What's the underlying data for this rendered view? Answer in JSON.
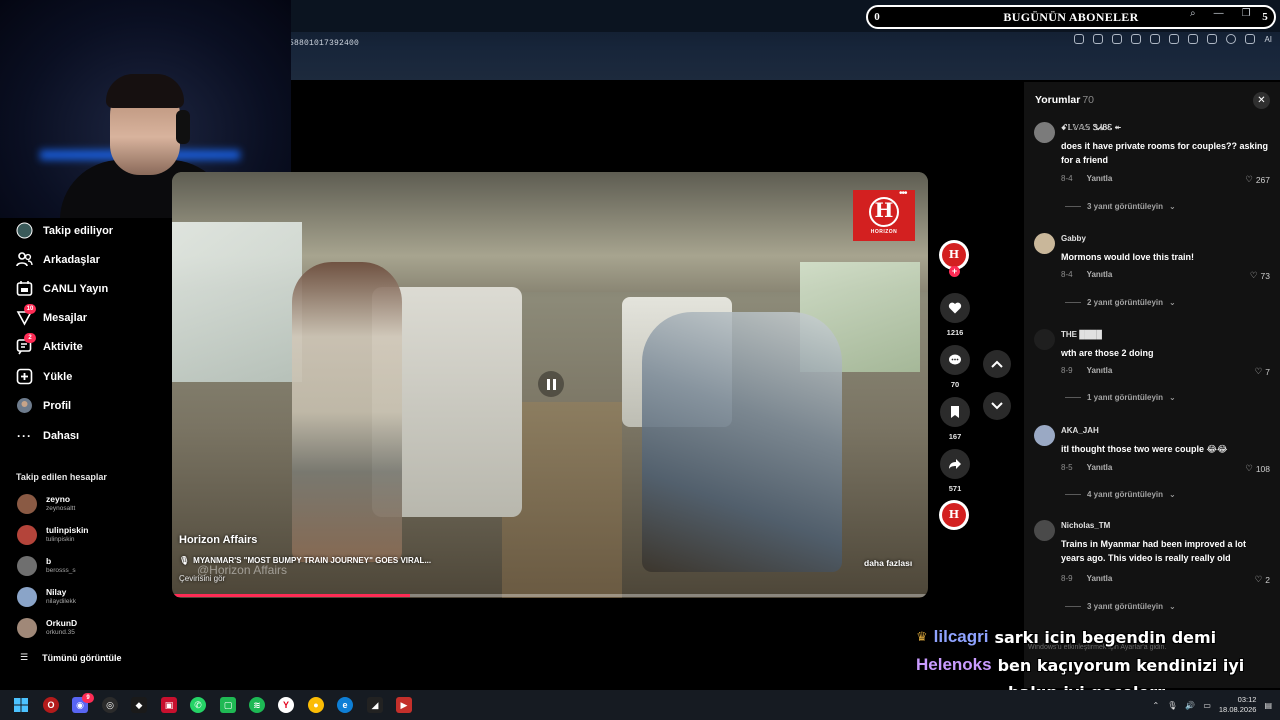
{
  "browser": {
    "url_fragment": "058801017392400",
    "ext_ai_label": "AI"
  },
  "subs_bar": {
    "left_count": "0",
    "title": "BUGÜNÜN ABONELER",
    "right_count": "5"
  },
  "sidebar": {
    "items": [
      {
        "label": "Takip ediliyor",
        "icon": "following-icon"
      },
      {
        "label": "Arkadaşlar",
        "icon": "friends-icon"
      },
      {
        "label": "CANLI Yayın",
        "icon": "live-icon"
      },
      {
        "label": "Mesajlar",
        "icon": "messages-icon",
        "badge": "10"
      },
      {
        "label": "Aktivite",
        "icon": "activity-icon",
        "badge": "2"
      },
      {
        "label": "Yükle",
        "icon": "upload-icon"
      },
      {
        "label": "Profil",
        "icon": "profile-icon"
      },
      {
        "label": "Dahası",
        "icon": "more-icon"
      }
    ],
    "following_title": "Takip edilen hesaplar",
    "accounts": [
      {
        "name": "zeyno",
        "handle": "zeynosaltt",
        "color": "#8a5a44"
      },
      {
        "name": "tulinpiskin",
        "handle": "tulinpiskin",
        "color": "#b4443a"
      },
      {
        "name": "b",
        "handle": "berosss_s",
        "color": "#6f6f6f"
      },
      {
        "name": "Nilay",
        "handle": "nilaydilekk",
        "color": "#8aa4c8"
      },
      {
        "name": "OrkunD",
        "handle": "orkund.35",
        "color": "#a08878"
      }
    ],
    "see_all": "Tümünü görüntüle"
  },
  "video": {
    "author": "Horizon Affairs",
    "description": "MYANMAR'S \"MOST BUMPY TRAIN JOURNEY\" GOES VIRAL...",
    "watermark": "@Horizon Affairs",
    "translate": "Çevirisini gör",
    "more": "daha fazlası",
    "logo_mark": "H",
    "logo_text": "HORIZON",
    "progress": 0.315
  },
  "actions": {
    "likes": "1216",
    "comments": "70",
    "saves": "167",
    "shares": "571",
    "avatar_mark": "H"
  },
  "comments_panel": {
    "title": "Yorumlar",
    "count": "70",
    "close": "✕",
    "reply_label": "Yanıtla",
    "items": [
      {
        "user": "ꗃ𝕃𝕍𝔸𝕊 ᏕᏗᏰᏋ ↞",
        "text": "does it have private rooms for couples?? asking for a friend",
        "date": "8-4",
        "likes": "267",
        "replies": "3 yanıt görüntüleyin",
        "avatar": "#7b7b7b"
      },
      {
        "user": "Gabby",
        "text": "Mormons would love this train!",
        "date": "8-4",
        "likes": "73",
        "replies": "2 yanıt görüntüleyin",
        "avatar": "#c9b79a"
      },
      {
        "user": "THE ████",
        "text": "wth are those 2 doing",
        "date": "8-9",
        "likes": "7",
        "replies": "1 yanıt görüntüleyin",
        "avatar": "#1f1f1f"
      },
      {
        "user": "AKA_JAH",
        "text": "itl thought those two were couple 😂😂",
        "date": "8-5",
        "likes": "108",
        "replies": "4 yanıt görüntüleyin",
        "avatar": "#9aa9c4"
      },
      {
        "user": "Nicholas_TM",
        "text": "Trains in Myanmar had been improved a lot years ago. This video is really really old",
        "date": "8-9",
        "likes": "2",
        "replies": "3 yanıt görüntüleyin",
        "avatar": "#4a4a4a"
      }
    ]
  },
  "chat": {
    "messages": [
      {
        "name": "lilcagri",
        "color": "#8fa3ff",
        "text": "sarkı icin begendin demi",
        "crown": "♛"
      },
      {
        "name": "Helenoks",
        "color": "#c99bff",
        "text": "ben kaçıyorum kendinizi iyi"
      },
      {
        "name": "",
        "color": "#ffffff",
        "text": "bakın iyi gecelerr"
      }
    ],
    "windows_watermark": "Windows'u etkinleştirmek için Ayarlar'a gidin."
  },
  "taskbar": {
    "time": "03:12",
    "date": "18.08.2026",
    "mail_badge": "9"
  },
  "colors": {
    "accent": "#fe2c55",
    "panel": "#121212"
  }
}
